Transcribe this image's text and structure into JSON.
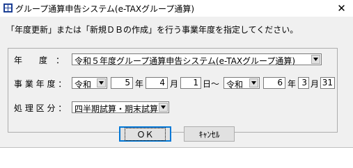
{
  "window": {
    "title": "グループ通算申告システム(e-TAXグループ通算)",
    "close_glyph": "✕"
  },
  "instruction": "「年度更新」または「新規ＤＢの作成」を行う事業年度を指定してください。",
  "fields": {
    "fiscal_year": {
      "label": "年　　度　：",
      "value": "令和５年度グループ通算申告システム(e-TAXグループ通算)"
    },
    "period": {
      "label": "事 業 年 度 ：",
      "from_era": "令和",
      "from_year": "5",
      "from_month": "4",
      "from_day": "1",
      "separator": "日～",
      "to_era": "令和",
      "to_year": "6",
      "to_month": "3",
      "to_day": "31",
      "year_unit": "年",
      "month_unit": "月",
      "day_unit": "日"
    },
    "process_type": {
      "label": "処 理 区 分 ：",
      "value": "四半期試算・期末試算"
    }
  },
  "buttons": {
    "ok": "ＯＫ",
    "cancel": "ｷｬﾝｾﾙ"
  },
  "icons": {
    "app": "app-icon",
    "dropdown": "chevron-down-icon"
  }
}
